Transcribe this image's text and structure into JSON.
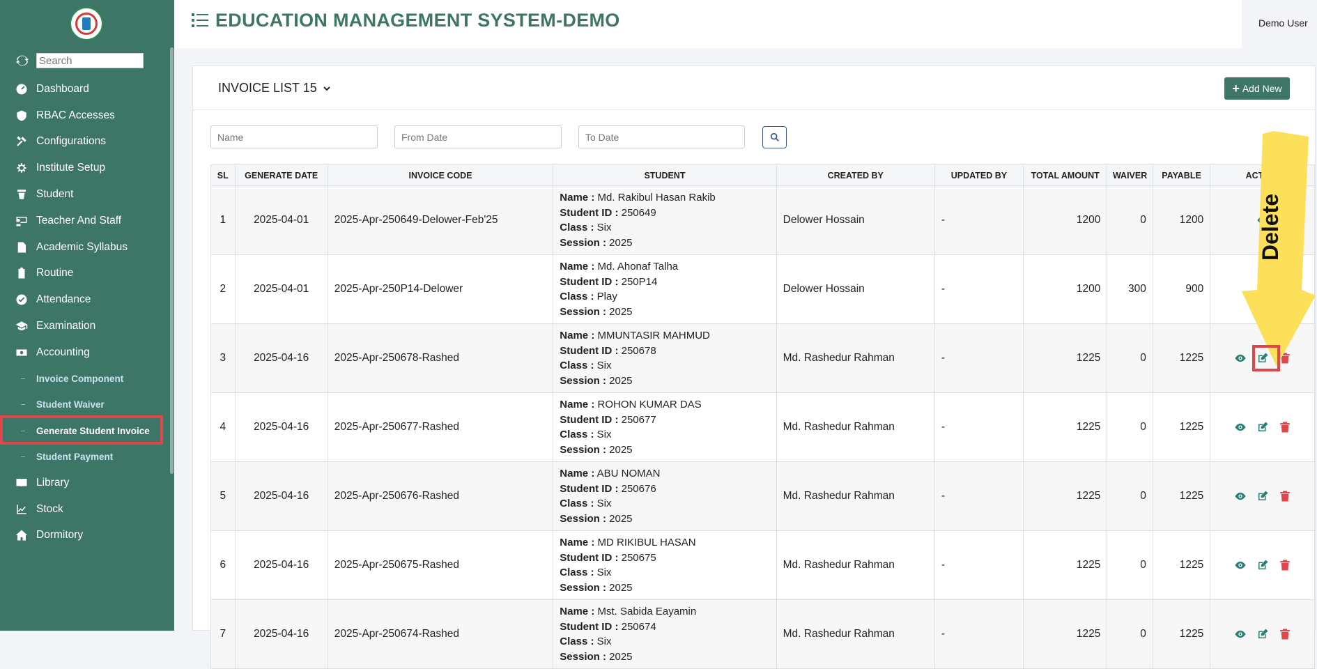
{
  "sidebar": {
    "search_placeholder": "Search",
    "items": [
      {
        "label": "Dashboard",
        "icon": "dashboard-icon"
      },
      {
        "label": "RBAC Accesses",
        "icon": "shield-icon"
      },
      {
        "label": "Configurations",
        "icon": "tools-icon"
      },
      {
        "label": "Institute Setup",
        "icon": "gear-icon"
      },
      {
        "label": "Student",
        "icon": "student-icon"
      },
      {
        "label": "Teacher And Staff",
        "icon": "teacher-icon"
      },
      {
        "label": "Academic Syllabus",
        "icon": "document-icon"
      },
      {
        "label": "Routine",
        "icon": "clipboard-icon"
      },
      {
        "label": "Attendance",
        "icon": "check-circle-icon"
      },
      {
        "label": "Examination",
        "icon": "graduation-cap-icon"
      },
      {
        "label": "Accounting",
        "icon": "money-icon"
      }
    ],
    "sub_items": [
      {
        "label": "Invoice Component"
      },
      {
        "label": "Student Waiver"
      },
      {
        "label": "Generate Student Invoice",
        "active": true
      },
      {
        "label": "Student Payment"
      }
    ],
    "items_after": [
      {
        "label": "Library",
        "icon": "book-icon"
      },
      {
        "label": "Stock",
        "icon": "chart-line-icon"
      },
      {
        "label": "Dormitory",
        "icon": "home-icon"
      }
    ]
  },
  "header": {
    "title": "EDUCATION MANAGEMENT SYSTEM-DEMO",
    "user": "Demo User"
  },
  "card": {
    "title": "INVOICE LIST 15",
    "add_button": "Add New"
  },
  "filters": {
    "name_placeholder": "Name",
    "from_placeholder": "From Date",
    "to_placeholder": "To Date"
  },
  "table": {
    "columns": [
      "SL",
      "GENERATE DATE",
      "INVOICE CODE",
      "STUDENT",
      "CREATED BY",
      "UPDATED BY",
      "TOTAL AMOUNT",
      "WAIVER",
      "PAYABLE",
      "ACTION"
    ],
    "student_labels": {
      "name": "Name :",
      "id": "Student ID :",
      "class": "Class :",
      "session": "Session :"
    },
    "rows": [
      {
        "sl": "1",
        "date": "2025-04-01",
        "code": "2025-Apr-250649-Delower-Feb'25",
        "name": "Md. Rakibul Hasan Rakib",
        "student_id": "250649",
        "class": "Six",
        "session": "2025",
        "created_by": "Delower Hossain",
        "updated_by": "-",
        "total": "1200",
        "waiver": "0",
        "payable": "1200",
        "actions": [
          "view"
        ]
      },
      {
        "sl": "2",
        "date": "2025-04-01",
        "code": "2025-Apr-250P14-Delower",
        "name": "Md. Ahonaf Talha",
        "student_id": "250P14",
        "class": "Play",
        "session": "2025",
        "created_by": "Delower Hossain",
        "updated_by": "-",
        "total": "1200",
        "waiver": "300",
        "payable": "900",
        "actions": [
          "view"
        ]
      },
      {
        "sl": "3",
        "date": "2025-04-16",
        "code": "2025-Apr-250678-Rashed",
        "name": "MMUNTASIR MAHMUD",
        "student_id": "250678",
        "class": "Six",
        "session": "2025",
        "created_by": "Md. Rashedur Rahman",
        "updated_by": "-",
        "total": "1225",
        "waiver": "0",
        "payable": "1225",
        "actions": [
          "view",
          "edit",
          "delete"
        ]
      },
      {
        "sl": "4",
        "date": "2025-04-16",
        "code": "2025-Apr-250677-Rashed",
        "name": "ROHON KUMAR DAS",
        "student_id": "250677",
        "class": "Six",
        "session": "2025",
        "created_by": "Md. Rashedur Rahman",
        "updated_by": "-",
        "total": "1225",
        "waiver": "0",
        "payable": "1225",
        "actions": [
          "view",
          "edit",
          "delete"
        ]
      },
      {
        "sl": "5",
        "date": "2025-04-16",
        "code": "2025-Apr-250676-Rashed",
        "name": "ABU NOMAN",
        "student_id": "250676",
        "class": "Six",
        "session": "2025",
        "created_by": "Md. Rashedur Rahman",
        "updated_by": "-",
        "total": "1225",
        "waiver": "0",
        "payable": "1225",
        "actions": [
          "view",
          "edit",
          "delete"
        ]
      },
      {
        "sl": "6",
        "date": "2025-04-16",
        "code": "2025-Apr-250675-Rashed",
        "name": "MD RIKIBUL HASAN",
        "student_id": "250675",
        "class": "Six",
        "session": "2025",
        "created_by": "Md. Rashedur Rahman",
        "updated_by": "-",
        "total": "1225",
        "waiver": "0",
        "payable": "1225",
        "actions": [
          "view",
          "edit",
          "delete"
        ]
      },
      {
        "sl": "7",
        "date": "2025-04-16",
        "code": "2025-Apr-250674-Rashed",
        "name": "Mst. Sabida Eayamin",
        "student_id": "250674",
        "class": "Six",
        "session": "2025",
        "created_by": "Md. Rashedur Rahman",
        "updated_by": "-",
        "total": "1225",
        "waiver": "0",
        "payable": "1225",
        "actions": [
          "view",
          "edit",
          "delete"
        ]
      }
    ]
  },
  "annotation": {
    "label": "Delete"
  },
  "colors": {
    "brand": "#3d7566",
    "highlight": "#e0474c",
    "arrow": "#fde05a",
    "delete": "#e0474c"
  }
}
